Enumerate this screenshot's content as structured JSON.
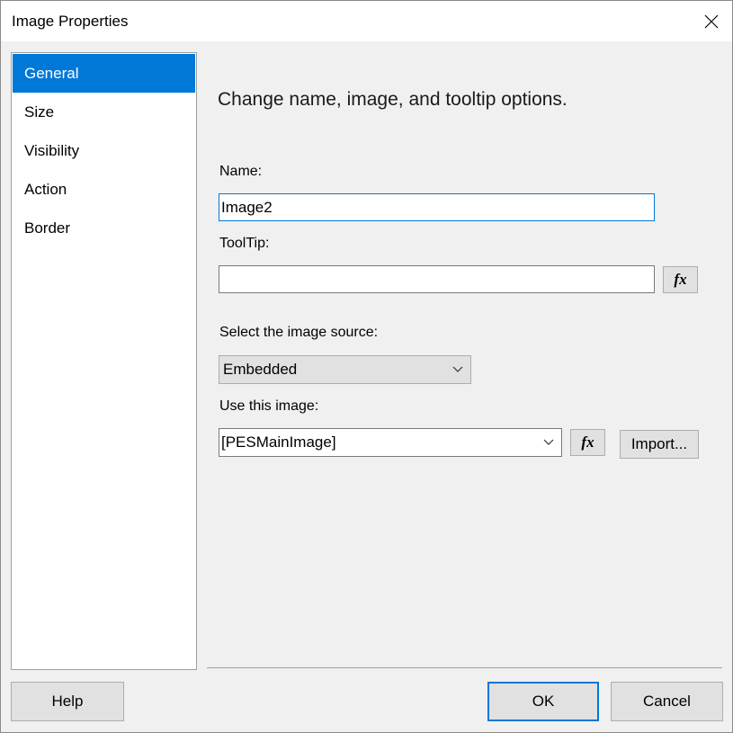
{
  "window": {
    "title": "Image Properties"
  },
  "nav": {
    "items": [
      {
        "label": "General",
        "selected": true
      },
      {
        "label": "Size",
        "selected": false
      },
      {
        "label": "Visibility",
        "selected": false
      },
      {
        "label": "Action",
        "selected": false
      },
      {
        "label": "Border",
        "selected": false
      }
    ]
  },
  "general": {
    "heading": "Change name, image, and tooltip options.",
    "name_label": "Name:",
    "name_value": "Image2",
    "tooltip_label": "ToolTip:",
    "tooltip_value": "",
    "fx_label": "fx",
    "source_label": "Select the image source:",
    "source_value": "Embedded",
    "image_label": "Use this image:",
    "image_value": "[PESMainImage]",
    "import_label": "Import..."
  },
  "footer": {
    "help_label": "Help",
    "ok_label": "OK",
    "cancel_label": "Cancel"
  },
  "colors": {
    "accent": "#0078d7",
    "dialog_bg": "#f0f0f0",
    "button_bg": "#e1e1e1"
  },
  "icons": {
    "close": "close-icon",
    "dropdown": "chevron-down-icon",
    "expression": "fx-icon"
  }
}
